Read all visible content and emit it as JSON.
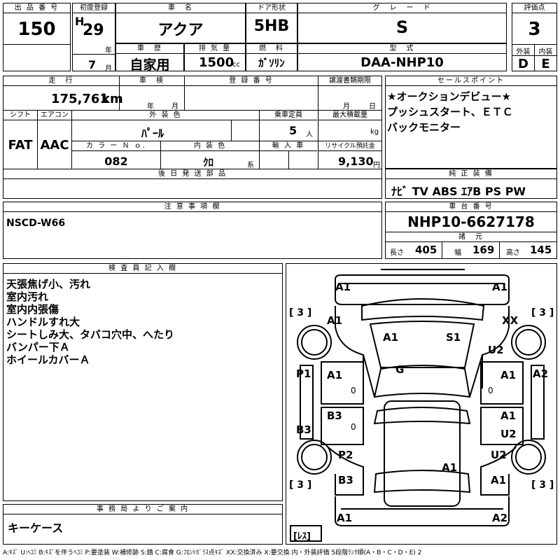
{
  "row1": {
    "lot_label": "出 品 番 号",
    "lot_no": "150",
    "first_reg_label": "初度登録",
    "era": "H",
    "year": "29",
    "year_unit": "年",
    "month": "7",
    "month_unit": "月",
    "name_label": "車　名",
    "name": "アクア",
    "door_label": "ドア形状",
    "door": "5HB",
    "grade_label": "グ　レ　ー　ド",
    "grade": "S",
    "score_label": "評価点",
    "score": "3",
    "history_label": "車　歴",
    "history": "自家用",
    "displacement_label": "排 気 量",
    "displacement": "1500",
    "cc": "cc",
    "fuel_label": "燃　料",
    "fuel": "ｶﾞｿﾘﾝ",
    "model_label": "型　式",
    "model": "DAA-NHP10",
    "ext_label": "外装",
    "ext": "D",
    "int_label": "内装",
    "int": "E"
  },
  "row2": {
    "mileage_label": "走　行",
    "mileage": "175,761",
    "km": "km",
    "inspection_label": "車　検",
    "insp_year_unit": "年",
    "insp_month_unit": "月",
    "regno_label": "登 録 番 号",
    "transfer_label": "譲渡書類期限",
    "tr_month_unit": "月",
    "tr_day_unit": "日",
    "shift_label": "シフト",
    "shift": "FAT",
    "ac_label": "エアコン",
    "ac": "AAC",
    "color_label": "外 装 色",
    "color": "ﾊﾟｰﾙ",
    "capacity_label": "乗車定員",
    "capacity": "5",
    "capacity_unit": "人",
    "load_label": "最大積載量",
    "load_unit": "kg",
    "colorno_label": "カ ラ ー Ｎ ｏ.",
    "colorno": "082",
    "intcolor_label": "内 装 色",
    "intcolor": "ｸﾛ",
    "intcolor_unit": "系",
    "import_label": "輸 入 車",
    "recycle_label": "リサイクル預託金",
    "recycle": "9,130",
    "recycle_unit": "円",
    "later_label": "後 日 発 送 部 品"
  },
  "sales": {
    "label": "セールスポイント",
    "lines": [
      "★オークションデビュー★",
      "プッシュスタート、ＥＴＣ",
      "バックモニター"
    ]
  },
  "equipment": {
    "label": "純 正 装 備",
    "value": "ﾅﾋﾞ TV ABS ｴｱB PS PW"
  },
  "caution": {
    "label": "注 意 事 項 欄",
    "value": "NSCD-W66"
  },
  "chassis": {
    "label": "車 台 番 号",
    "value": "NHP10-6627178",
    "spec_label": "諸　元",
    "length_label": "長さ",
    "length": "405",
    "width_label": "幅",
    "width": "169",
    "height_label": "高さ",
    "height": "145"
  },
  "inspector": {
    "label": "検 査 員 記 入 欄",
    "lines": [
      "天張焦げ小、汚れ",
      "室内汚れ",
      "室内内張傷",
      "ハンドルすれ大",
      "シートしみ大、タバコ穴中、へたり",
      "バンパー下Ａ",
      "ホイールカバーＡ"
    ]
  },
  "office": {
    "label": "事 務 局 よ り ご 案 内",
    "value": "キーケース"
  },
  "diagram": {
    "marks": {
      "front_left": "A1",
      "front_right": "A1",
      "tire_fl": "[ 3 ]",
      "tire_fr": "[ 3 ]",
      "fender_l": "A1",
      "fender_r": "XX",
      "hood_l": "A1",
      "hood_r": "S1",
      "windshield": "G",
      "pillar_l": "P1",
      "pillar_r": "A2",
      "door_fl": "A1",
      "door_fr": "A1",
      "door_rl": "B3",
      "door_rr": "A1",
      "u2_r1": "U2",
      "u2_r2": "U2",
      "u2_r3": "U2",
      "sill_l": "B3",
      "rear_fender_l": "P2",
      "rear_fender_l2": "B3",
      "trunk": "A1",
      "rear_r": "A1",
      "tire_rl": "[ 3 ]",
      "tire_rr": "[ 3 ]",
      "rear_bumper_l": "A1",
      "rear_bumper_r": "A2",
      "spare": "[ﾚｽ]",
      "zero": "0"
    }
  },
  "legend": "A:ｷｽﾞ U:ﾍｺﾐ B:ｷｽﾞを伴うﾍｺﾐ P:要塗装 W:補修跡 S:錆 C:腐食 G:ﾌﾛﾝﾄｶﾞﾗｽ点ｷｽﾞ XX:交換済み X:要交換 内・外装評価 5段階ﾗﾝｸ順(A・B・C・D・E) 2"
}
